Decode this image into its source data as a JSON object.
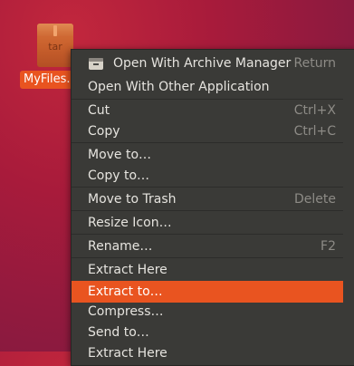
{
  "desktop": {
    "file_icon": {
      "name": "archive-icon",
      "type_label": "tar",
      "caption": "MyFiles."
    }
  },
  "context_menu": {
    "highlight_color": "#e95420",
    "items": [
      {
        "label": "Open With Archive Manager",
        "shortcut": "Return",
        "icon": "archive-manager-icon"
      },
      {
        "label": "Open With Other Application",
        "shortcut": ""
      },
      {
        "label": "Cut",
        "shortcut": "Ctrl+X"
      },
      {
        "label": "Copy",
        "shortcut": "Ctrl+C"
      },
      {
        "label": "Move to…",
        "shortcut": ""
      },
      {
        "label": "Copy to…",
        "shortcut": ""
      },
      {
        "label": "Move to Trash",
        "shortcut": "Delete"
      },
      {
        "label": "Resize Icon…",
        "shortcut": ""
      },
      {
        "label": "Rename…",
        "shortcut": "F2"
      },
      {
        "label": "Extract Here",
        "shortcut": ""
      },
      {
        "label": "Extract to…",
        "shortcut": "",
        "highlighted": true
      },
      {
        "label": "Compress…",
        "shortcut": ""
      },
      {
        "label": "Send to…",
        "shortcut": ""
      },
      {
        "label": "Extract Here",
        "shortcut": ""
      }
    ]
  }
}
